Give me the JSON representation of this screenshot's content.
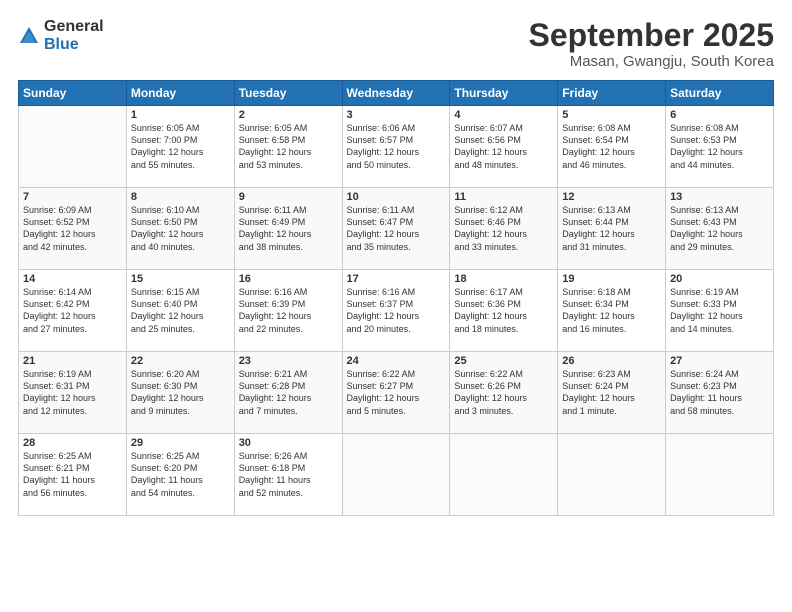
{
  "logo": {
    "general": "General",
    "blue": "Blue"
  },
  "title": "September 2025",
  "subtitle": "Masan, Gwangju, South Korea",
  "days_header": [
    "Sunday",
    "Monday",
    "Tuesday",
    "Wednesday",
    "Thursday",
    "Friday",
    "Saturday"
  ],
  "weeks": [
    [
      {
        "num": "",
        "lines": []
      },
      {
        "num": "1",
        "lines": [
          "Sunrise: 6:05 AM",
          "Sunset: 7:00 PM",
          "Daylight: 12 hours",
          "and 55 minutes."
        ]
      },
      {
        "num": "2",
        "lines": [
          "Sunrise: 6:05 AM",
          "Sunset: 6:58 PM",
          "Daylight: 12 hours",
          "and 53 minutes."
        ]
      },
      {
        "num": "3",
        "lines": [
          "Sunrise: 6:06 AM",
          "Sunset: 6:57 PM",
          "Daylight: 12 hours",
          "and 50 minutes."
        ]
      },
      {
        "num": "4",
        "lines": [
          "Sunrise: 6:07 AM",
          "Sunset: 6:56 PM",
          "Daylight: 12 hours",
          "and 48 minutes."
        ]
      },
      {
        "num": "5",
        "lines": [
          "Sunrise: 6:08 AM",
          "Sunset: 6:54 PM",
          "Daylight: 12 hours",
          "and 46 minutes."
        ]
      },
      {
        "num": "6",
        "lines": [
          "Sunrise: 6:08 AM",
          "Sunset: 6:53 PM",
          "Daylight: 12 hours",
          "and 44 minutes."
        ]
      }
    ],
    [
      {
        "num": "7",
        "lines": [
          "Sunrise: 6:09 AM",
          "Sunset: 6:52 PM",
          "Daylight: 12 hours",
          "and 42 minutes."
        ]
      },
      {
        "num": "8",
        "lines": [
          "Sunrise: 6:10 AM",
          "Sunset: 6:50 PM",
          "Daylight: 12 hours",
          "and 40 minutes."
        ]
      },
      {
        "num": "9",
        "lines": [
          "Sunrise: 6:11 AM",
          "Sunset: 6:49 PM",
          "Daylight: 12 hours",
          "and 38 minutes."
        ]
      },
      {
        "num": "10",
        "lines": [
          "Sunrise: 6:11 AM",
          "Sunset: 6:47 PM",
          "Daylight: 12 hours",
          "and 35 minutes."
        ]
      },
      {
        "num": "11",
        "lines": [
          "Sunrise: 6:12 AM",
          "Sunset: 6:46 PM",
          "Daylight: 12 hours",
          "and 33 minutes."
        ]
      },
      {
        "num": "12",
        "lines": [
          "Sunrise: 6:13 AM",
          "Sunset: 6:44 PM",
          "Daylight: 12 hours",
          "and 31 minutes."
        ]
      },
      {
        "num": "13",
        "lines": [
          "Sunrise: 6:13 AM",
          "Sunset: 6:43 PM",
          "Daylight: 12 hours",
          "and 29 minutes."
        ]
      }
    ],
    [
      {
        "num": "14",
        "lines": [
          "Sunrise: 6:14 AM",
          "Sunset: 6:42 PM",
          "Daylight: 12 hours",
          "and 27 minutes."
        ]
      },
      {
        "num": "15",
        "lines": [
          "Sunrise: 6:15 AM",
          "Sunset: 6:40 PM",
          "Daylight: 12 hours",
          "and 25 minutes."
        ]
      },
      {
        "num": "16",
        "lines": [
          "Sunrise: 6:16 AM",
          "Sunset: 6:39 PM",
          "Daylight: 12 hours",
          "and 22 minutes."
        ]
      },
      {
        "num": "17",
        "lines": [
          "Sunrise: 6:16 AM",
          "Sunset: 6:37 PM",
          "Daylight: 12 hours",
          "and 20 minutes."
        ]
      },
      {
        "num": "18",
        "lines": [
          "Sunrise: 6:17 AM",
          "Sunset: 6:36 PM",
          "Daylight: 12 hours",
          "and 18 minutes."
        ]
      },
      {
        "num": "19",
        "lines": [
          "Sunrise: 6:18 AM",
          "Sunset: 6:34 PM",
          "Daylight: 12 hours",
          "and 16 minutes."
        ]
      },
      {
        "num": "20",
        "lines": [
          "Sunrise: 6:19 AM",
          "Sunset: 6:33 PM",
          "Daylight: 12 hours",
          "and 14 minutes."
        ]
      }
    ],
    [
      {
        "num": "21",
        "lines": [
          "Sunrise: 6:19 AM",
          "Sunset: 6:31 PM",
          "Daylight: 12 hours",
          "and 12 minutes."
        ]
      },
      {
        "num": "22",
        "lines": [
          "Sunrise: 6:20 AM",
          "Sunset: 6:30 PM",
          "Daylight: 12 hours",
          "and 9 minutes."
        ]
      },
      {
        "num": "23",
        "lines": [
          "Sunrise: 6:21 AM",
          "Sunset: 6:28 PM",
          "Daylight: 12 hours",
          "and 7 minutes."
        ]
      },
      {
        "num": "24",
        "lines": [
          "Sunrise: 6:22 AM",
          "Sunset: 6:27 PM",
          "Daylight: 12 hours",
          "and 5 minutes."
        ]
      },
      {
        "num": "25",
        "lines": [
          "Sunrise: 6:22 AM",
          "Sunset: 6:26 PM",
          "Daylight: 12 hours",
          "and 3 minutes."
        ]
      },
      {
        "num": "26",
        "lines": [
          "Sunrise: 6:23 AM",
          "Sunset: 6:24 PM",
          "Daylight: 12 hours",
          "and 1 minute."
        ]
      },
      {
        "num": "27",
        "lines": [
          "Sunrise: 6:24 AM",
          "Sunset: 6:23 PM",
          "Daylight: 11 hours",
          "and 58 minutes."
        ]
      }
    ],
    [
      {
        "num": "28",
        "lines": [
          "Sunrise: 6:25 AM",
          "Sunset: 6:21 PM",
          "Daylight: 11 hours",
          "and 56 minutes."
        ]
      },
      {
        "num": "29",
        "lines": [
          "Sunrise: 6:25 AM",
          "Sunset: 6:20 PM",
          "Daylight: 11 hours",
          "and 54 minutes."
        ]
      },
      {
        "num": "30",
        "lines": [
          "Sunrise: 6:26 AM",
          "Sunset: 6:18 PM",
          "Daylight: 11 hours",
          "and 52 minutes."
        ]
      },
      {
        "num": "",
        "lines": []
      },
      {
        "num": "",
        "lines": []
      },
      {
        "num": "",
        "lines": []
      },
      {
        "num": "",
        "lines": []
      }
    ]
  ]
}
